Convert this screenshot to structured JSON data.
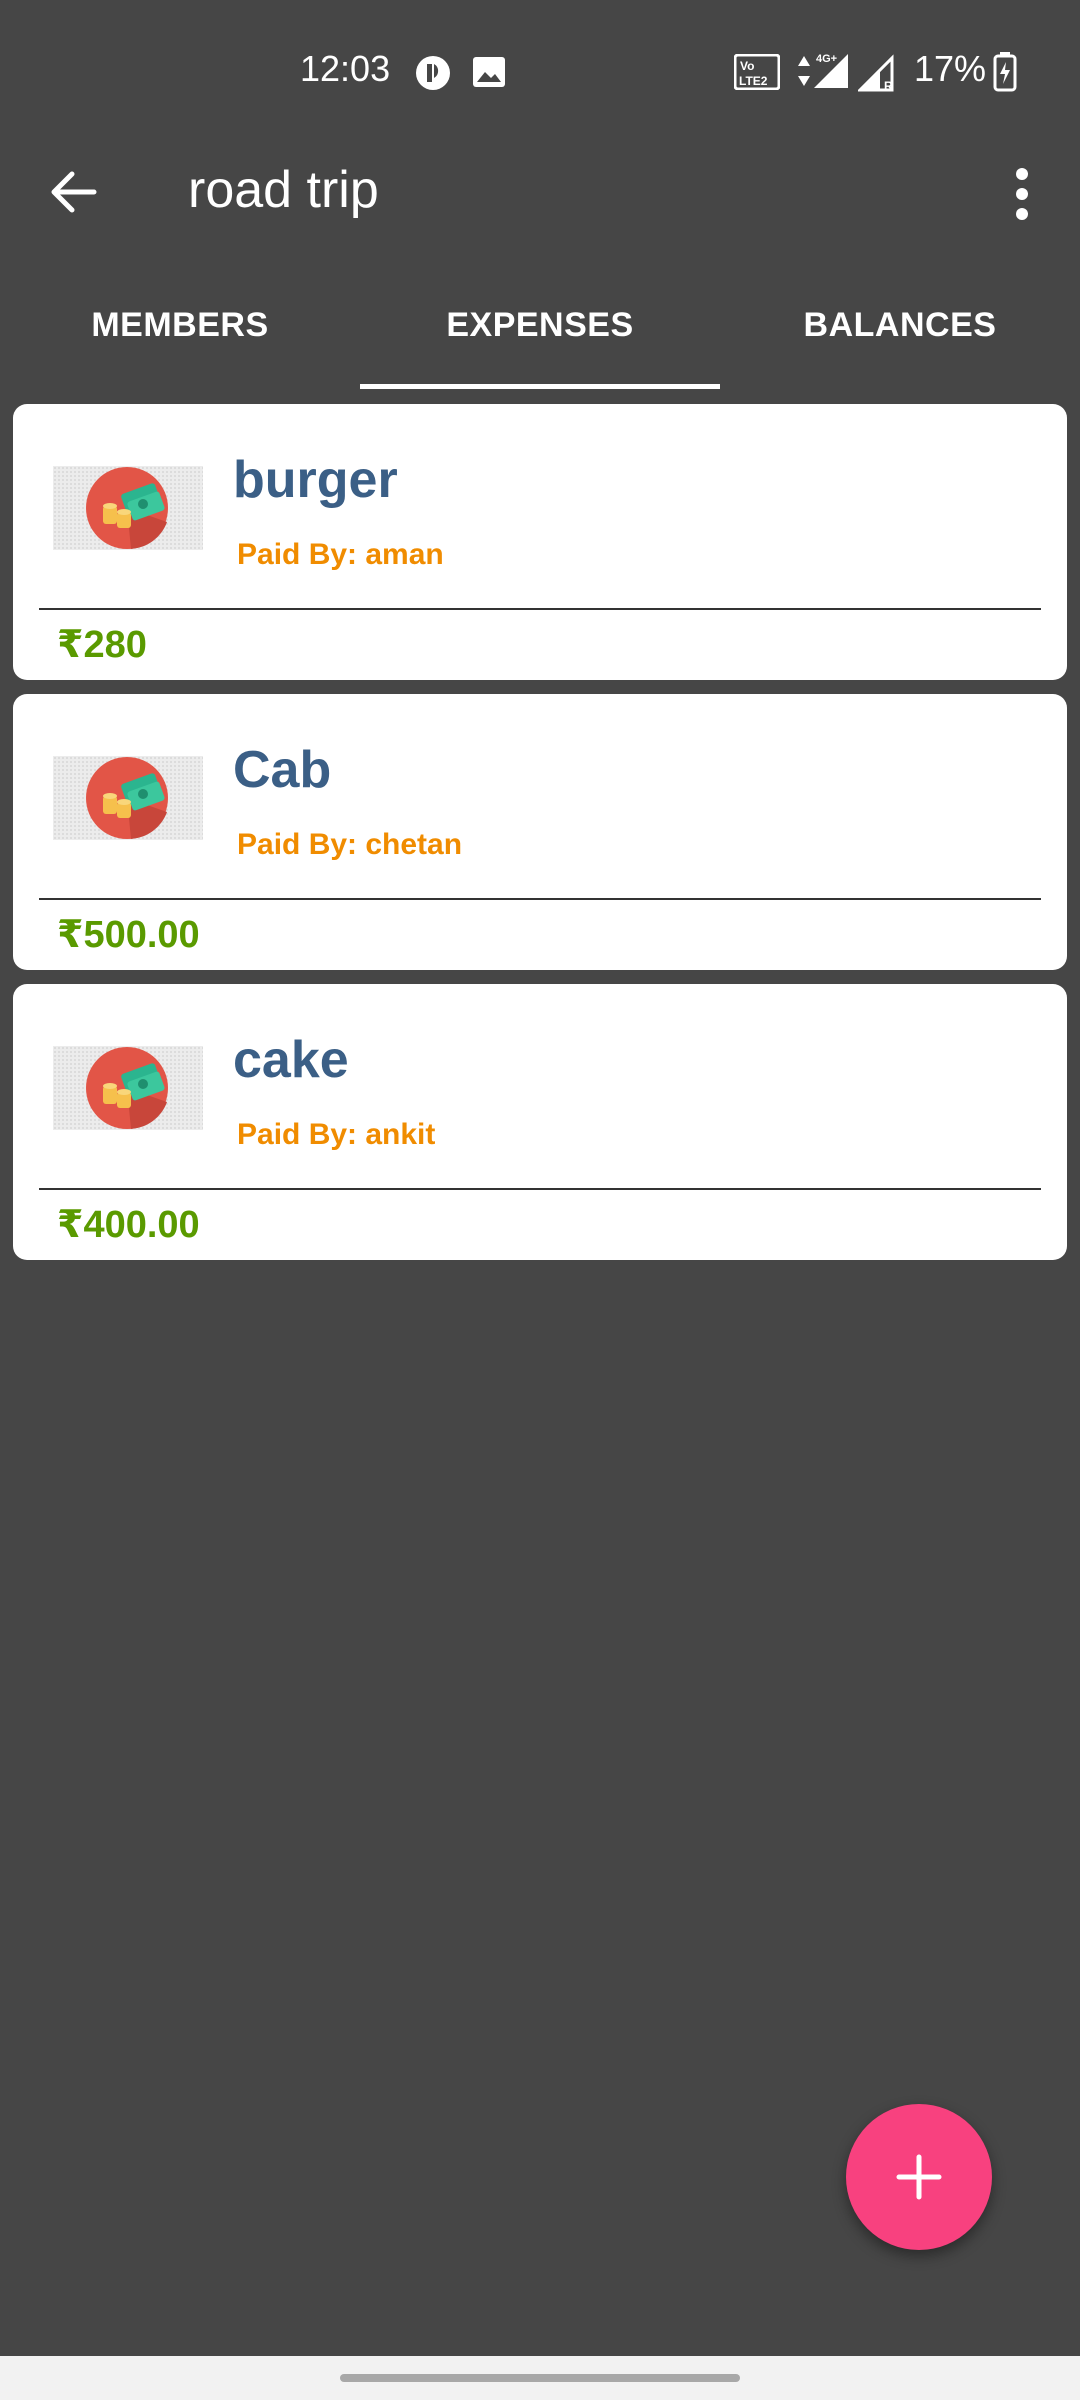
{
  "status_bar": {
    "time": "12:03",
    "battery": "17%",
    "icons": [
      "notification-app-icon",
      "gallery-icon",
      "volte-icon",
      "data-arrows-icon",
      "signal-4g-icon",
      "signal-roaming-icon",
      "battery-icon"
    ]
  },
  "app_bar": {
    "title": "road trip",
    "back_icon": "arrow-back-icon",
    "menu_icon": "more-vert-icon"
  },
  "tabs": [
    {
      "label": "MEMBERS",
      "selected": false
    },
    {
      "label": "EXPENSES",
      "selected": true
    },
    {
      "label": "BALANCES",
      "selected": false
    }
  ],
  "expenses": [
    {
      "name": "burger",
      "paid_by": "Paid By: aman",
      "currency": "₹",
      "amount": "280"
    },
    {
      "name": "Cab",
      "paid_by": "Paid By: chetan",
      "currency": "₹",
      "amount": "500.00"
    },
    {
      "name": "cake",
      "paid_by": "Paid By: ankit",
      "currency": "₹",
      "amount": "400.00"
    }
  ],
  "fab": {
    "icon": "plus-icon"
  },
  "colors": {
    "background": "#464646",
    "title": "#3b5f86",
    "paid_by": "#f08c00",
    "amount": "#5a9a00",
    "fab": "#f8417f"
  }
}
